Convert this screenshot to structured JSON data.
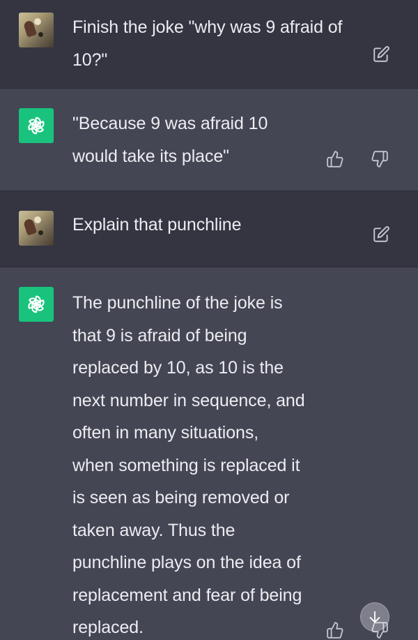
{
  "messages": [
    {
      "role": "user",
      "lines": [
        "Finish the joke \"why was 9 afraid of",
        "10?\""
      ]
    },
    {
      "role": "assistant",
      "lines": [
        "\"Because 9 was afraid 10",
        "would take its place\""
      ]
    },
    {
      "role": "user",
      "lines": [
        "Explain that punchline"
      ]
    },
    {
      "role": "assistant",
      "lines": [
        "The punchline of the joke is",
        "that 9 is afraid of being",
        "replaced by 10, as 10 is the",
        "next number in sequence, and",
        "often in many situations,",
        "when something is replaced it",
        "is seen as being removed or",
        "taken away. Thus the",
        "punchline plays on the idea of",
        "replacement and fear of being",
        "replaced."
      ]
    }
  ],
  "icons": {
    "edit": "edit-icon",
    "thumbs_up": "thumbs-up-icon",
    "thumbs_down": "thumbs-down-icon",
    "scroll_down": "arrow-down-icon",
    "assistant_logo": "openai-logo-icon"
  },
  "colors": {
    "user_bg": "#343541",
    "assistant_bg": "#444654",
    "text": "#ececf1",
    "icon": "#c5c5d2",
    "assistant_avatar": "#19c37d"
  }
}
